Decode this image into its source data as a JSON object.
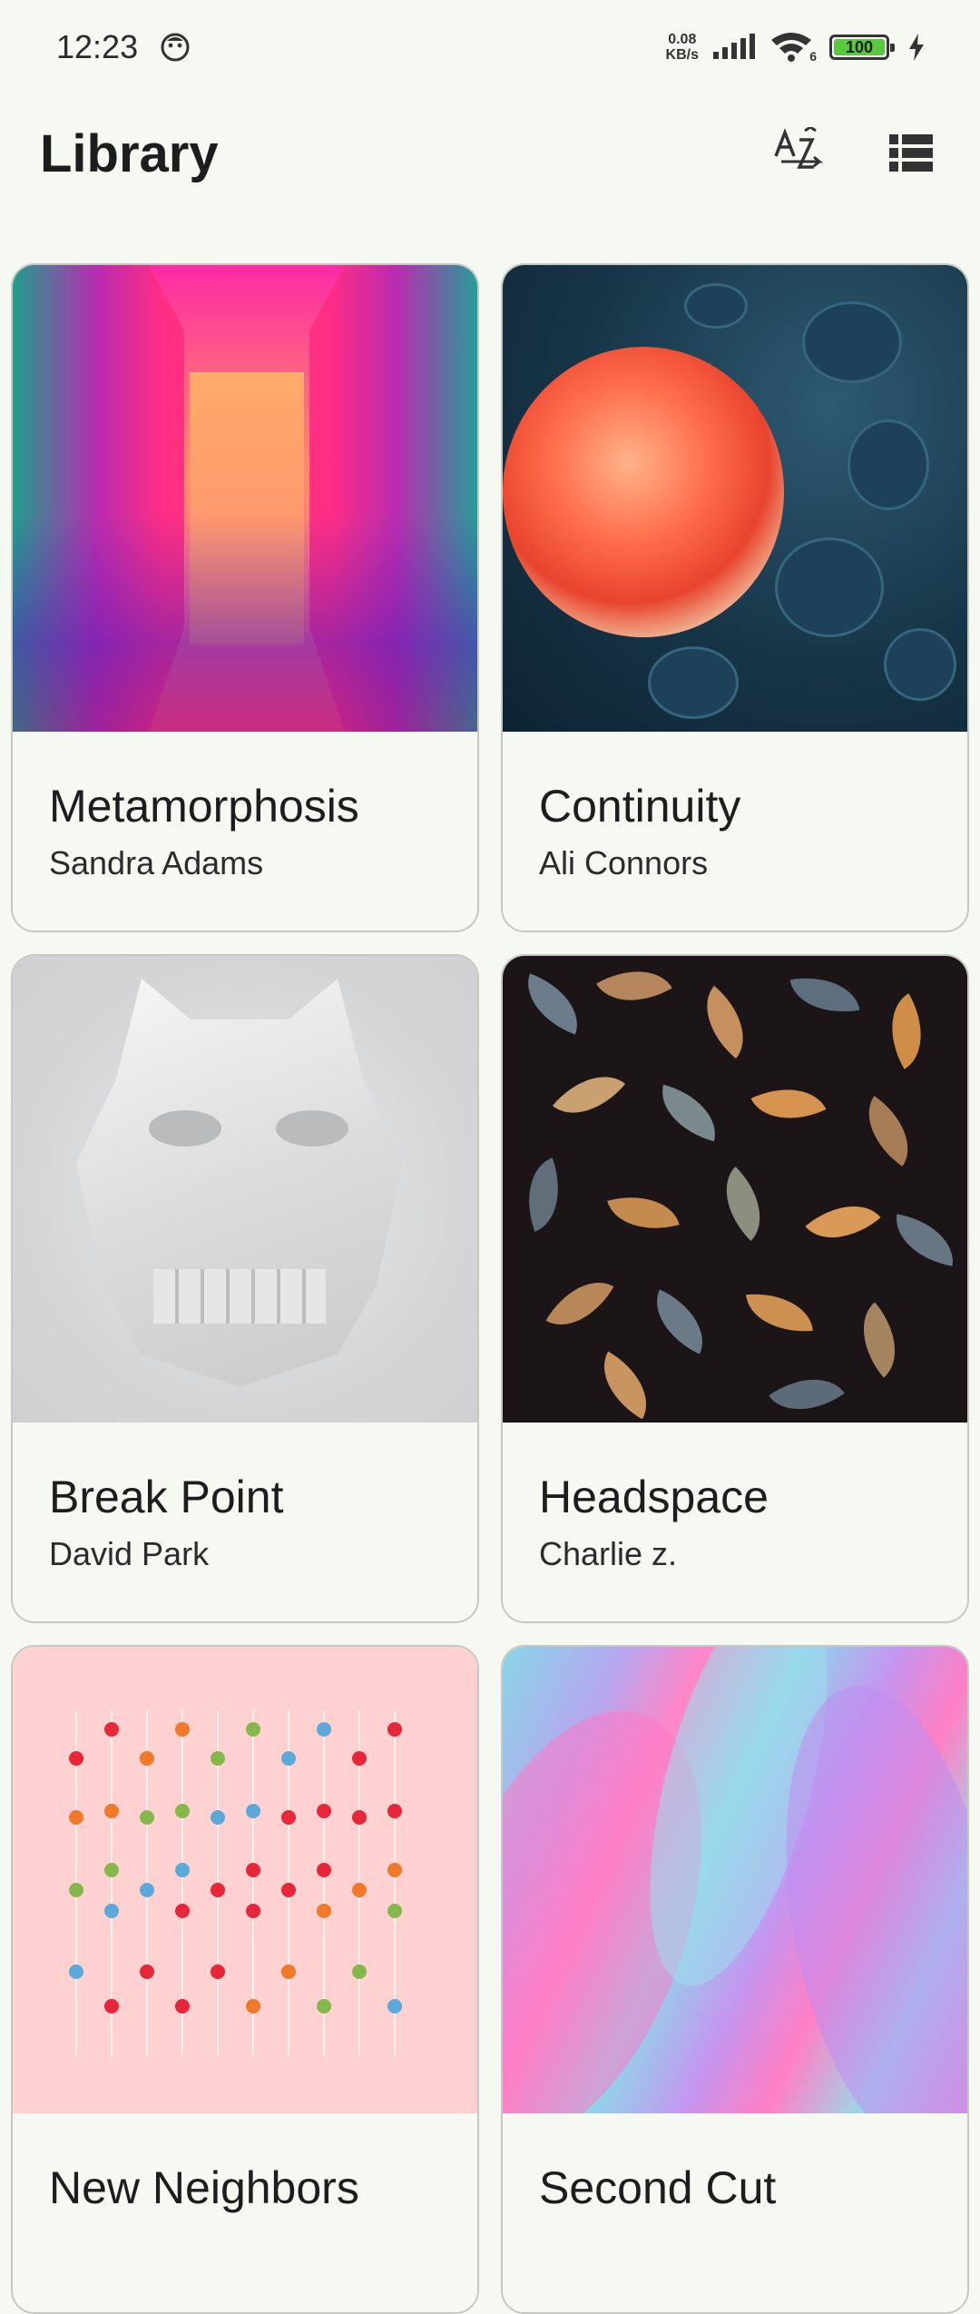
{
  "status_bar": {
    "time": "12:23",
    "net_speed_value": "0.08",
    "net_speed_unit": "KB/s",
    "battery_level": "100",
    "wifi_label": "6"
  },
  "header": {
    "title": "Library"
  },
  "cards": [
    {
      "title": "Metamorphosis",
      "author": "Sandra Adams"
    },
    {
      "title": "Continuity",
      "author": "Ali Connors"
    },
    {
      "title": "Break Point",
      "author": "David Park"
    },
    {
      "title": "Headspace",
      "author": "Charlie z."
    },
    {
      "title": "New Neighbors",
      "author": ""
    },
    {
      "title": "Second Cut",
      "author": ""
    }
  ],
  "colors": {
    "background": "#f6f9f2",
    "card_border": "#c6c9c1",
    "text_primary": "#1d1d1d",
    "battery_fill": "#58c93e"
  },
  "icons": {
    "sort": "sort-az-icon",
    "view": "list-view-icon"
  }
}
